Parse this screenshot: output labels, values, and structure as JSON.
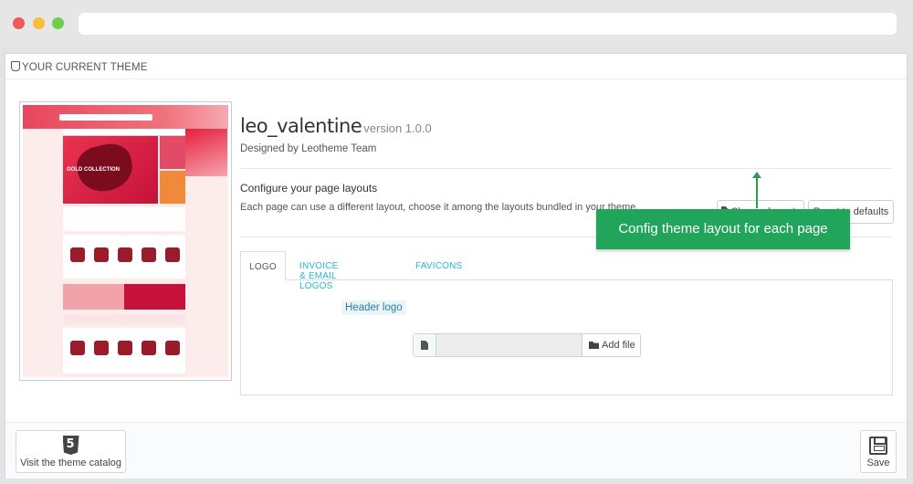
{
  "panel": {
    "title": "YOUR CURRENT THEME"
  },
  "theme": {
    "name": "leo_valentine",
    "version": "version 1.0.0",
    "author": "Designed by Leotheme Team",
    "preview_banner_text": "GOLD COLLECTION"
  },
  "layouts": {
    "title": "Configure your page layouts",
    "description": "Each page can use a different layout, choose it among the layouts bundled in your theme.",
    "choose_label": "Choose layouts",
    "reset_label": "Reset to defaults"
  },
  "callout": {
    "text": "Config theme layout for each page",
    "color": "#21a55a"
  },
  "tabs": [
    {
      "label": "LOGO",
      "active": true
    },
    {
      "label": "INVOICE & EMAIL LOGOS",
      "active": false
    },
    {
      "label": "FAVICONS",
      "active": false
    }
  ],
  "logo_tab": {
    "header_logo_label": "Header logo",
    "add_file_label": "Add file"
  },
  "footer": {
    "catalog_label": "Visit the theme catalog",
    "save_label": "Save"
  },
  "colors": {
    "accent_link": "#25b9d7",
    "theme_pink": "#e8465c"
  }
}
